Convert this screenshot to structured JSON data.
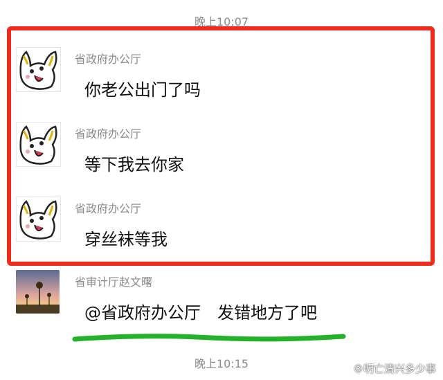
{
  "timestamps": {
    "top": "晚上10:07",
    "bottom": "晚上10:15"
  },
  "messages": [
    {
      "sender": "省政府办公厅",
      "text": "你老公出门了吗",
      "avatar": "cartoon-bunny-icon"
    },
    {
      "sender": "省政府办公厅",
      "text": "等下我去你家",
      "avatar": "cartoon-bunny-icon"
    },
    {
      "sender": "省政府办公厅",
      "text": "穿丝袜等我",
      "avatar": "cartoon-bunny-icon"
    },
    {
      "sender": "省审计厅赵文曙",
      "text": "@省政府办公厅　发错地方了吧",
      "avatar": "sunflower-sunset-photo"
    }
  ],
  "watermark": "®明亡清兴多少事",
  "colors": {
    "highlight_box": "#f12b1c",
    "underline": "#22b22b",
    "background": "#ffffff"
  }
}
